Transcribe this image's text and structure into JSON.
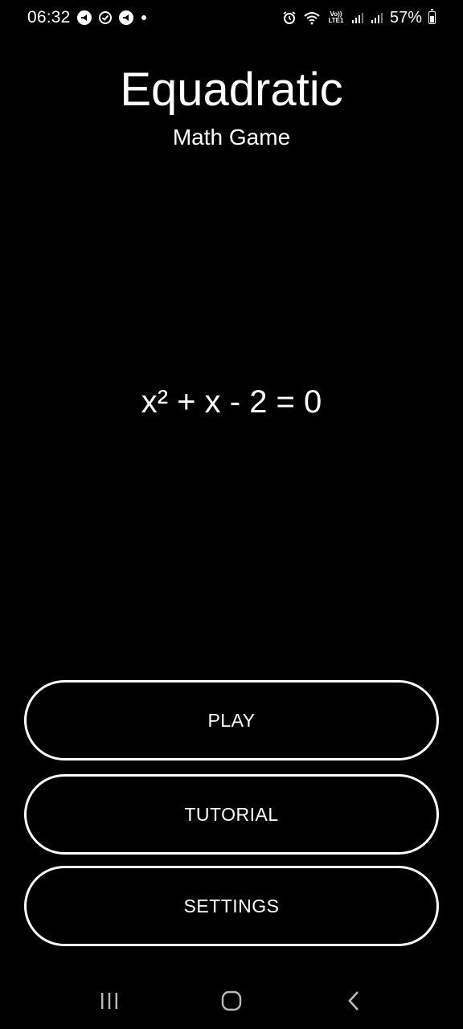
{
  "status_bar": {
    "time": "06:32",
    "battery_percent": "57%",
    "volte_label": "Vo)) LTE1",
    "icons": [
      "notification-icon",
      "check-circle-icon",
      "notification-icon",
      "dot-icon",
      "alarm-icon",
      "wifi-icon",
      "signal-icon",
      "signal-icon",
      "battery-icon"
    ]
  },
  "app": {
    "title": "Equadratic",
    "subtitle": "Math Game",
    "equation": "x² + x - 2 = 0"
  },
  "menu": {
    "play_label": "PLAY",
    "tutorial_label": "TUTORIAL",
    "settings_label": "SETTINGS"
  },
  "nav_bar": {
    "icons": [
      "recent-apps-icon",
      "home-icon",
      "back-icon"
    ]
  },
  "colors": {
    "background": "#000000",
    "foreground": "#ffffff"
  }
}
